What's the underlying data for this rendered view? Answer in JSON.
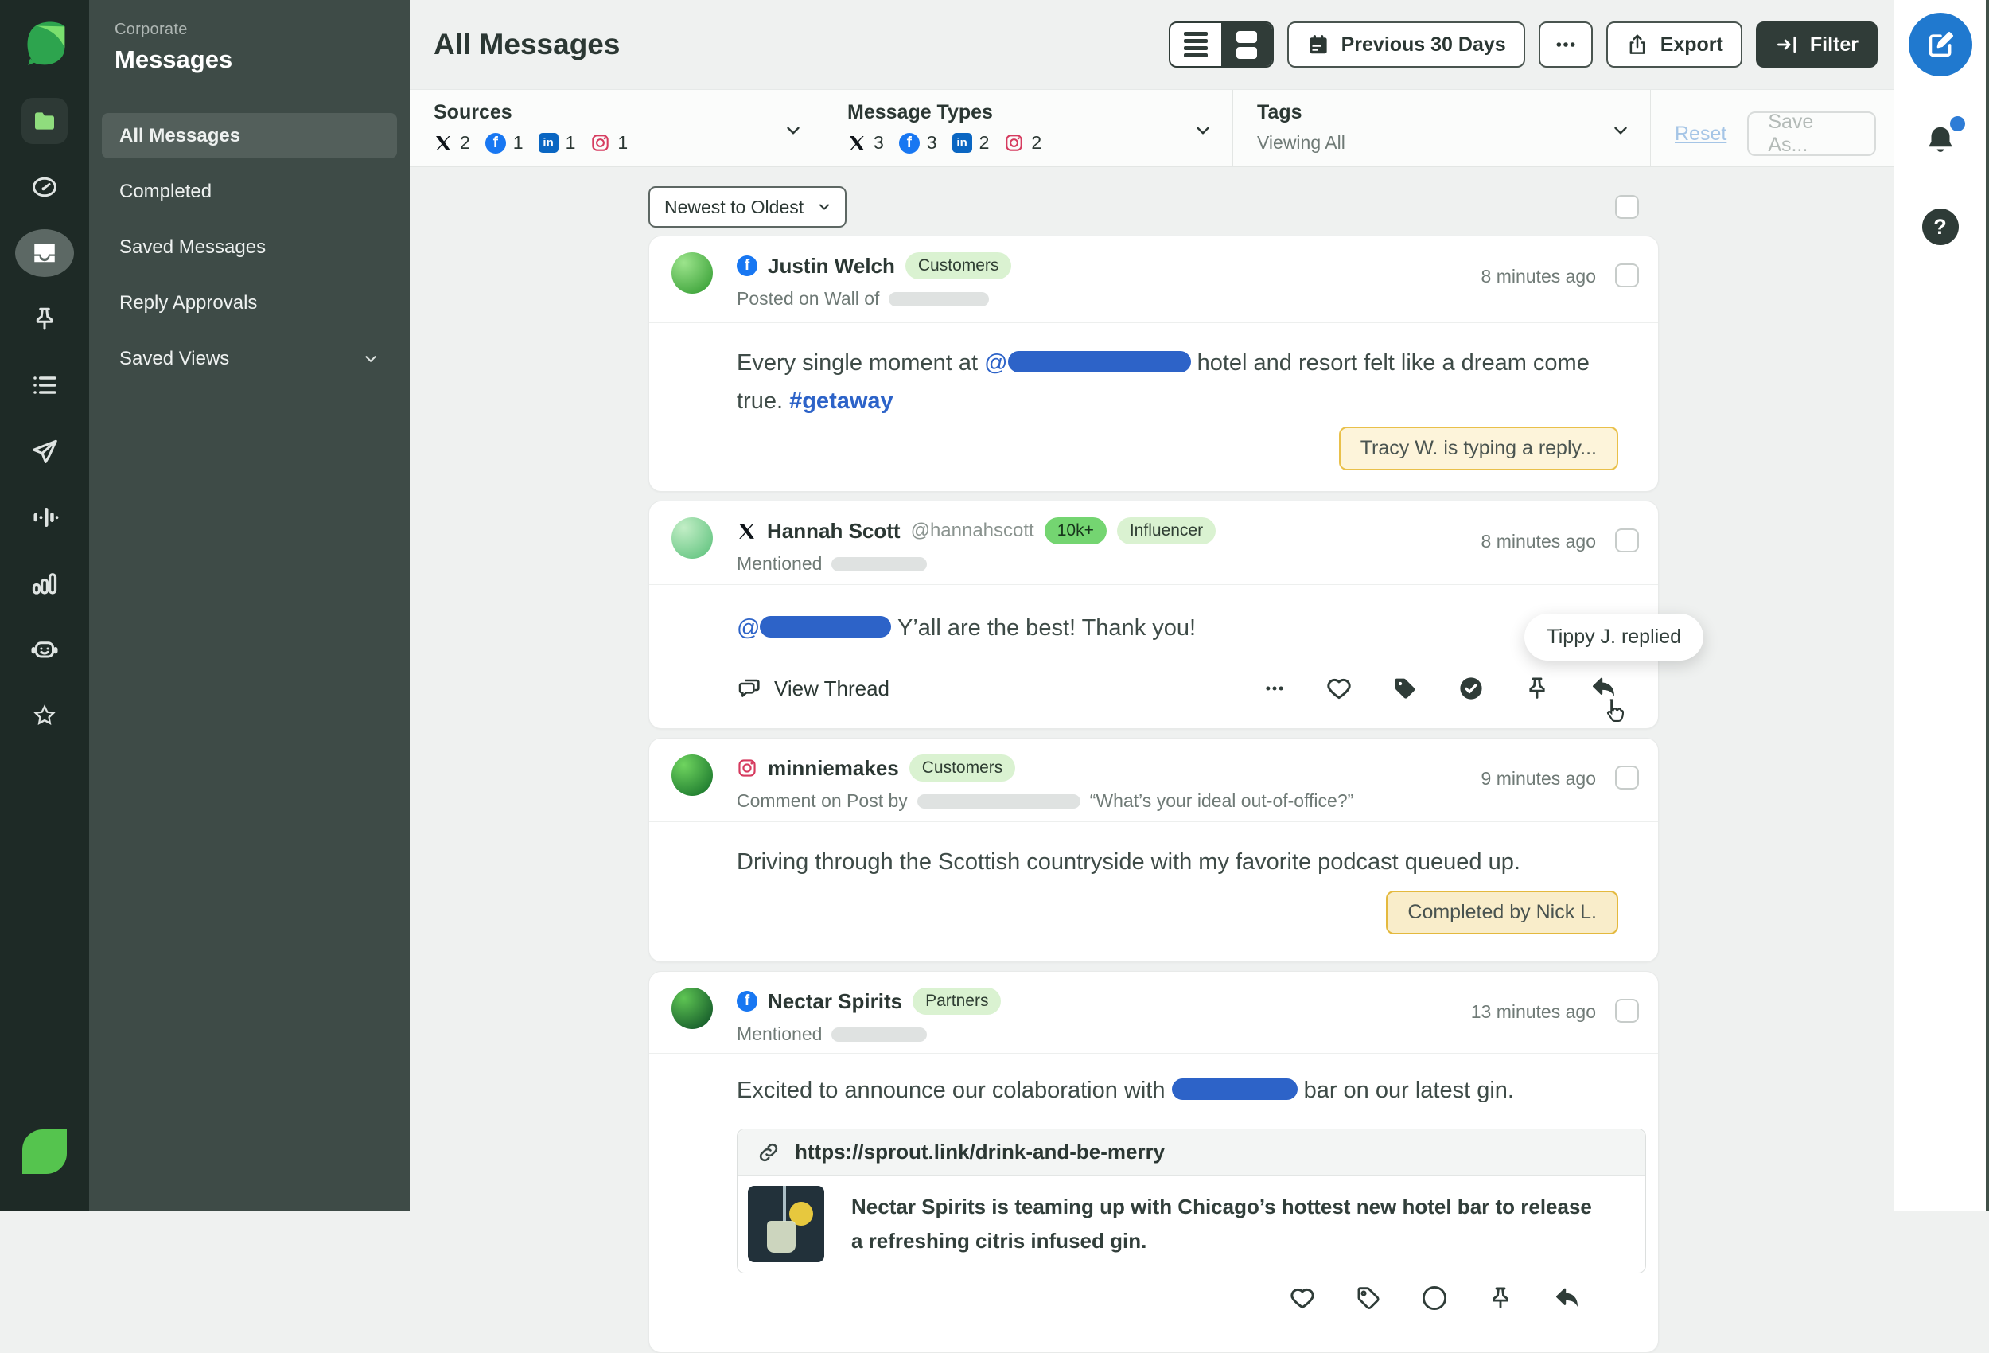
{
  "sidebar": {
    "workspace_label": "Corporate",
    "title": "Messages",
    "items": [
      {
        "label": "All Messages",
        "active": true
      },
      {
        "label": "Completed",
        "active": false
      },
      {
        "label": "Saved Messages",
        "active": false
      },
      {
        "label": "Reply Approvals",
        "active": false
      },
      {
        "label": "Saved Views",
        "active": false,
        "expandable": true
      }
    ]
  },
  "rail_icons": [
    "sprout-leaf-logo",
    "folder",
    "dashboard-gauge",
    "inbox",
    "pin",
    "lists",
    "publishing-plane",
    "listening-waveform",
    "reports-bars",
    "bot",
    "reviews-star",
    "workspace-leaf"
  ],
  "header": {
    "title": "All Messages",
    "view_toggle": [
      "list-view",
      "card-view-active"
    ],
    "date_range_label": "Previous 30 Days",
    "more_icon": "ellipsis",
    "export_label": "Export",
    "filter_label": "Filter"
  },
  "filterbar": {
    "sources": {
      "label": "Sources",
      "counts": {
        "x": 2,
        "facebook": 1,
        "linkedin": 1,
        "instagram": 1
      }
    },
    "message_types": {
      "label": "Message Types",
      "counts": {
        "x": 3,
        "facebook": 3,
        "linkedin": 2,
        "instagram": 2
      }
    },
    "tags": {
      "label": "Tags",
      "value": "Viewing All"
    },
    "reset_label": "Reset",
    "save_as_label": "Save As..."
  },
  "list": {
    "sort_value": "Newest to Oldest",
    "messages": [
      {
        "network": "facebook",
        "name": "Justin Welch",
        "badges": [
          "Customers"
        ],
        "context": "Posted on Wall of",
        "time": "8 minutes ago",
        "body_before": "Every single moment at ",
        "mention_symbol": "@",
        "body_after": " hotel and resort felt like a dream come true. ",
        "hashtag": "#getaway",
        "status_badge": "Tracy W. is typing a reply..."
      },
      {
        "network": "x",
        "name": "Hannah Scott",
        "handle": "@hannahscott",
        "badges": [
          "10k+",
          "Influencer"
        ],
        "context": "Mentioned",
        "time": "8 minutes ago",
        "mention_symbol": "@",
        "body_after": " Y’all are the best! Thank you!",
        "view_thread_label": "View Thread",
        "tooltip": "Tippy J. replied"
      },
      {
        "network": "instagram",
        "name": "minniemakes",
        "badges": [
          "Customers"
        ],
        "context": "Comment on Post by",
        "context_quote": "“What’s your ideal out-of-office?”",
        "time": "9 minutes ago",
        "body": "Driving through the Scottish countryside with my favorite podcast queued up.",
        "status_badge": "Completed by Nick L."
      },
      {
        "network": "facebook",
        "name": "Nectar Spirits",
        "badges": [
          "Partners"
        ],
        "context": "Mentioned",
        "time": "13 minutes ago",
        "body_before": "Excited to announce our colaboration with ",
        "body_after": " bar on our latest gin.",
        "link_preview": {
          "url": "https://sprout.link/drink-and-be-merry",
          "description": "Nectar Spirits is teaming up with Chicago’s hottest new hotel bar to release a refreshing citris infused gin."
        }
      }
    ]
  },
  "right_rail": {
    "icons": [
      "compose",
      "notifications-bell-with-dot",
      "help"
    ]
  },
  "colors": {
    "rail_bg": "#1e2a26",
    "sidenav_bg": "#3e4b47",
    "accent_green": "#2da44e",
    "facebook_blue": "#1877f2",
    "linkedin_blue": "#0a66c2",
    "instagram_red": "#d63b5f",
    "link_blue": "#2d63c8",
    "typing_badge_border": "#e9c04a",
    "compose_blue": "#2079cf"
  }
}
